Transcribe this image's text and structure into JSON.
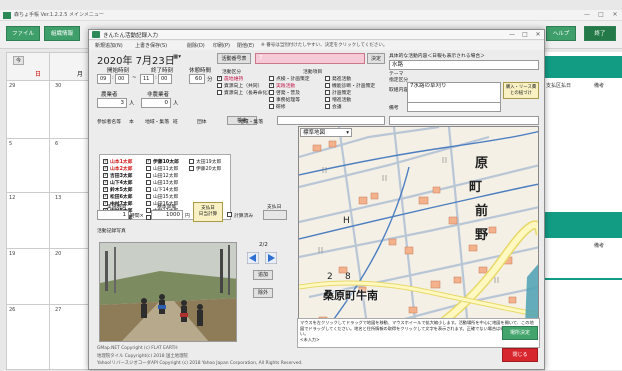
{
  "background": {
    "title": "森ちょ手帳  Ver.1.2.2.5  メインメニュー",
    "window_controls": [
      "—",
      "□",
      "✕"
    ],
    "toolbar": {
      "file_label": "ファイル",
      "org_label": "組織情報",
      "help_label": "ヘルプ",
      "exit_label": "終了"
    },
    "calendar": {
      "today_label": "今",
      "weekdays": [
        "日",
        "月"
      ],
      "dates": [
        "29",
        "30",
        "5",
        "6",
        "12",
        "13",
        "19",
        "20",
        "26",
        "27"
      ]
    },
    "right_panel": {
      "col1": "支払区払日",
      "col2": "備考",
      "col3": "備考"
    }
  },
  "dialog": {
    "title": "きんたん活動記録入力",
    "window_controls": [
      "—",
      "□",
      "✕"
    ],
    "menu": [
      "新規追加(N)",
      "上書き保存(S)",
      "削除(D)",
      "印刷(P)",
      "閉他(E)"
    ],
    "menu_note": "※ 番号は当別付けたしやすい、決定をクリックしてください。",
    "date": "2020年 7月23日",
    "date_btn": "▦▾",
    "start_label": "開始時刻",
    "end_label": "終了時刻",
    "rest_label": "休憩時間",
    "start_h": "09",
    "start_m": "00",
    "end_h": "11",
    "end_m": "00",
    "rest_value": "60",
    "rest_unit": "分",
    "participants_label": "農業者",
    "participants_value": "3",
    "participants_unit": "人",
    "nonfarm_label": "非農業者",
    "nonfarm_value": "0",
    "nonfarm_unit": "人",
    "filter_tabs": [
      "参加者名等",
      "本",
      "地域・集落",
      "班",
      "団体"
    ],
    "search_label": "検索",
    "people_col1": [
      {
        "name": "山本1太郎",
        "checked": true
      },
      {
        "name": "山本2太郎",
        "checked": true
      },
      {
        "name": "吉田3太郎",
        "checked": true
      },
      {
        "name": "山下4太郎",
        "checked": true
      },
      {
        "name": "鈴木5太郎",
        "checked": true
      },
      {
        "name": "松田6太郎",
        "checked": true
      },
      {
        "name": "中村7太郎",
        "checked": true
      },
      {
        "name": "中村8太郎",
        "checked": true
      },
      {
        "name": "太田9太郎",
        "checked": true
      }
    ],
    "people_col2": [
      {
        "name": "伊藤10太郎",
        "checked": true
      },
      {
        "name": "山田11太郎",
        "checked": false
      },
      {
        "name": "山田12太郎",
        "checked": false
      },
      {
        "name": "山田13太郎",
        "checked": false
      },
      {
        "name": "山下14太郎",
        "checked": false
      },
      {
        "name": "山田15太郎",
        "checked": false
      },
      {
        "name": "山田16太郎",
        "checked": false
      },
      {
        "name": "中村17太郎",
        "checked": false
      },
      {
        "name": "平川18太郎",
        "checked": false
      }
    ],
    "people_col3": [
      {
        "name": "太田19太郎",
        "checked": false
      },
      {
        "name": "伊藤20太郎",
        "checked": false
      }
    ],
    "wage_label": "実施時間",
    "wage_hours": "1",
    "wage_hours_unit": "時間×",
    "unit_cost_label": "基本単価",
    "unit_cost": "1000",
    "unit_cost_unit": "円",
    "pay_btn": "支払日\n日当計算",
    "calc_check_label": "計算済み",
    "pay_day_label": "支払日",
    "photo_label": "活動記録写真",
    "photo_count": "2/2",
    "add_btn": "追加",
    "del_btn": "除外",
    "copyright_lines": [
      "GMap.NET Copyright (c) FLAT EARTH",
      "地理院タイル Copyright(c) 2018 国土地理院",
      "Yahoo!リバースジオコーダAPI Copyright (c) 2018 Yahoo Japan Corporation, All Rights Reserved."
    ],
    "activity_no_btn": "活動番号表",
    "activity_no": "7",
    "decide_btn": "決定",
    "activity_type_label": "活動区分",
    "category_label": "活動項目",
    "categories_col1": [
      {
        "label": "農地維持",
        "checked": true,
        "pink": true
      },
      {
        "label": "資源向上（共同）",
        "checked": false,
        "pink": false
      },
      {
        "label": "資源向上（長寿命化）",
        "checked": false,
        "pink": false
      }
    ],
    "categories_col2": [
      {
        "label": "点検・計画策定",
        "checked": false,
        "pink": false
      },
      {
        "label": "実践活動",
        "checked": true,
        "pink": true
      },
      {
        "label": "啓発・普及",
        "checked": false,
        "pink": false
      },
      {
        "label": "事務処理等",
        "checked": false,
        "pink": false
      },
      {
        "label": "研修",
        "checked": false,
        "pink": false
      }
    ],
    "categories_col3": [
      {
        "label": "発進活動",
        "checked": false,
        "pink": false
      },
      {
        "label": "機能診断・計画策定",
        "checked": false,
        "pink": false
      },
      {
        "label": "計画策定",
        "checked": false,
        "pink": false
      },
      {
        "label": "増進活動",
        "checked": false,
        "pink": false
      },
      {
        "label": "会議",
        "checked": false,
        "pink": false
      }
    ],
    "main_content_label": "具体的な活動内容＜日報も表示される場合＞",
    "main_content_value": "水路",
    "theme_label": "テーマ\n指定区分",
    "recorded_label": "取組内容",
    "recorded_value": "7水路の草刈り",
    "import_btn": "購入・リース費\nとの紐づけ",
    "remarks_label": "備考",
    "region_label": "地域・集落",
    "activity_place_label": "活動場所",
    "map_mode": "標準地図",
    "map_place_name": "桑原町牛南",
    "map_caption": "マウスを左クリックしてドラッグで地図を移動、マウスホイールで拡大縮小します。活動場所を中心に地図を開いて、この地図でドラッグしてください。地名と住所情報の取得をクリックして文字を表示されます。正確でない場合は修正してください。",
    "map_address": "<未入力>",
    "map_decide_btn": "場所決定",
    "close_btn": "閉じる"
  },
  "colors": {
    "accent_green": "#3e9f6a",
    "teal": "#129c83",
    "close_red": "#d8262e",
    "pink_label": "#c21d4a"
  }
}
